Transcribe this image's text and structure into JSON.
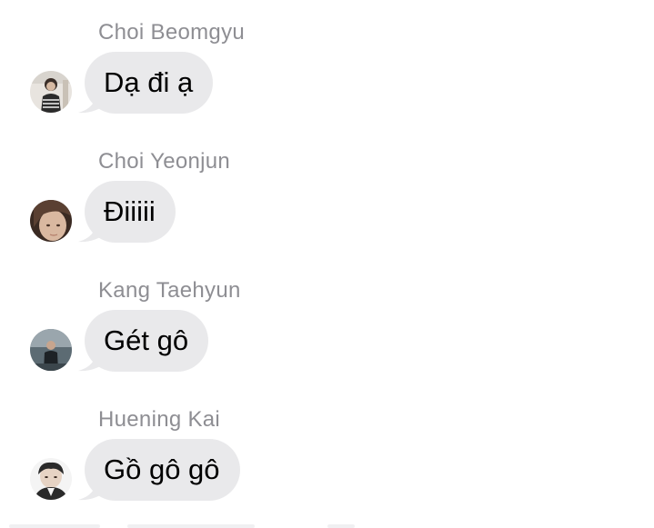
{
  "messages": [
    {
      "sender": "Choi Beomgyu",
      "text": "Dạ đi ạ",
      "avatar_icon": "avatar-beomgyu-icon",
      "avatar_colors": [
        "#e8e4df",
        "#2b2b2b",
        "#c9c1b6"
      ]
    },
    {
      "sender": "Choi Yeonjun",
      "text": "Điiiii",
      "avatar_icon": "avatar-yeonjun-icon",
      "avatar_colors": [
        "#3a2a22",
        "#d9b8a0",
        "#5a4032"
      ]
    },
    {
      "sender": "Kang Taehyun",
      "text": "Gét gô",
      "avatar_icon": "avatar-taehyun-icon",
      "avatar_colors": [
        "#5c6b73",
        "#1d2226",
        "#9aa6ad"
      ]
    },
    {
      "sender": "Huening Kai",
      "text": "Gồ gô gô",
      "avatar_icon": "avatar-huening-icon",
      "avatar_colors": [
        "#2a2a2a",
        "#e6d3c4",
        "#f4f4f4"
      ]
    }
  ],
  "colors": {
    "bubble": "#e9e9eb",
    "sender_name": "#8e8e93",
    "text": "#000000",
    "background": "#ffffff"
  }
}
